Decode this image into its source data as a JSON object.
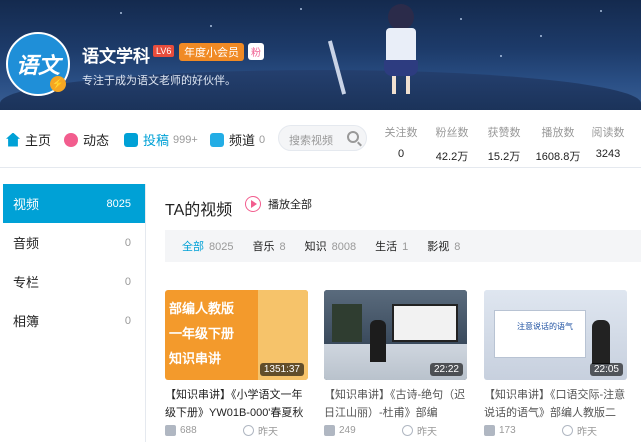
{
  "banner": {
    "avatar_text": "语文",
    "verified_badge": "⚡",
    "username": "语文学科",
    "level": "LV6",
    "vip_label": "年度小会员",
    "fan_label": "粉",
    "signature": "专注于成为语文老师的好伙伴。"
  },
  "nav": {
    "tabs": [
      {
        "label": "主页",
        "count": ""
      },
      {
        "label": "动态",
        "count": ""
      },
      {
        "label": "投稿",
        "count": "999+"
      },
      {
        "label": "频道",
        "count": "0"
      }
    ],
    "search_placeholder": "搜索视频",
    "stats": [
      {
        "label": "关注数",
        "value": "0"
      },
      {
        "label": "粉丝数",
        "value": "42.2万"
      },
      {
        "label": "获赞数",
        "value": "15.2万"
      },
      {
        "label": "播放数",
        "value": "1608.8万"
      },
      {
        "label": "阅读数",
        "value": "3243"
      }
    ]
  },
  "sidebar": {
    "items": [
      {
        "label": "视频",
        "count": "8025"
      },
      {
        "label": "音频",
        "count": "0"
      },
      {
        "label": "专栏",
        "count": "0"
      },
      {
        "label": "相簿",
        "count": "0"
      }
    ]
  },
  "main": {
    "title": "TA的视频",
    "play_all": "播放全部",
    "filters": [
      {
        "label": "全部",
        "count": "8025"
      },
      {
        "label": "音乐",
        "count": "8"
      },
      {
        "label": "知识",
        "count": "8008"
      },
      {
        "label": "生活",
        "count": "1"
      },
      {
        "label": "影视",
        "count": "8"
      }
    ],
    "videos": [
      {
        "thumb_lines": [
          "部编人教版",
          "一年级下册",
          "知识串讲"
        ],
        "duration": "1351:37",
        "title": "【知识串讲】《小学语文一年级下册》YW01B-000'春夏秋",
        "plays": "688",
        "time": "昨天"
      },
      {
        "duration": "22:22",
        "title": "【知识串讲】《古诗-绝句（迟日江山丽）-杜甫》部编",
        "plays": "249",
        "time": "昨天"
      },
      {
        "thumb_caption": "注意说话的语气",
        "duration": "22:05",
        "title": "【知识串讲】《口语交际-注意说话的语气》部编人教版二",
        "plays": "173",
        "time": "昨天"
      }
    ]
  },
  "colors": {
    "accent": "#00a1d6",
    "vip": "#f08a24",
    "level": "#e74c3c",
    "pink": "#f25d8e"
  }
}
